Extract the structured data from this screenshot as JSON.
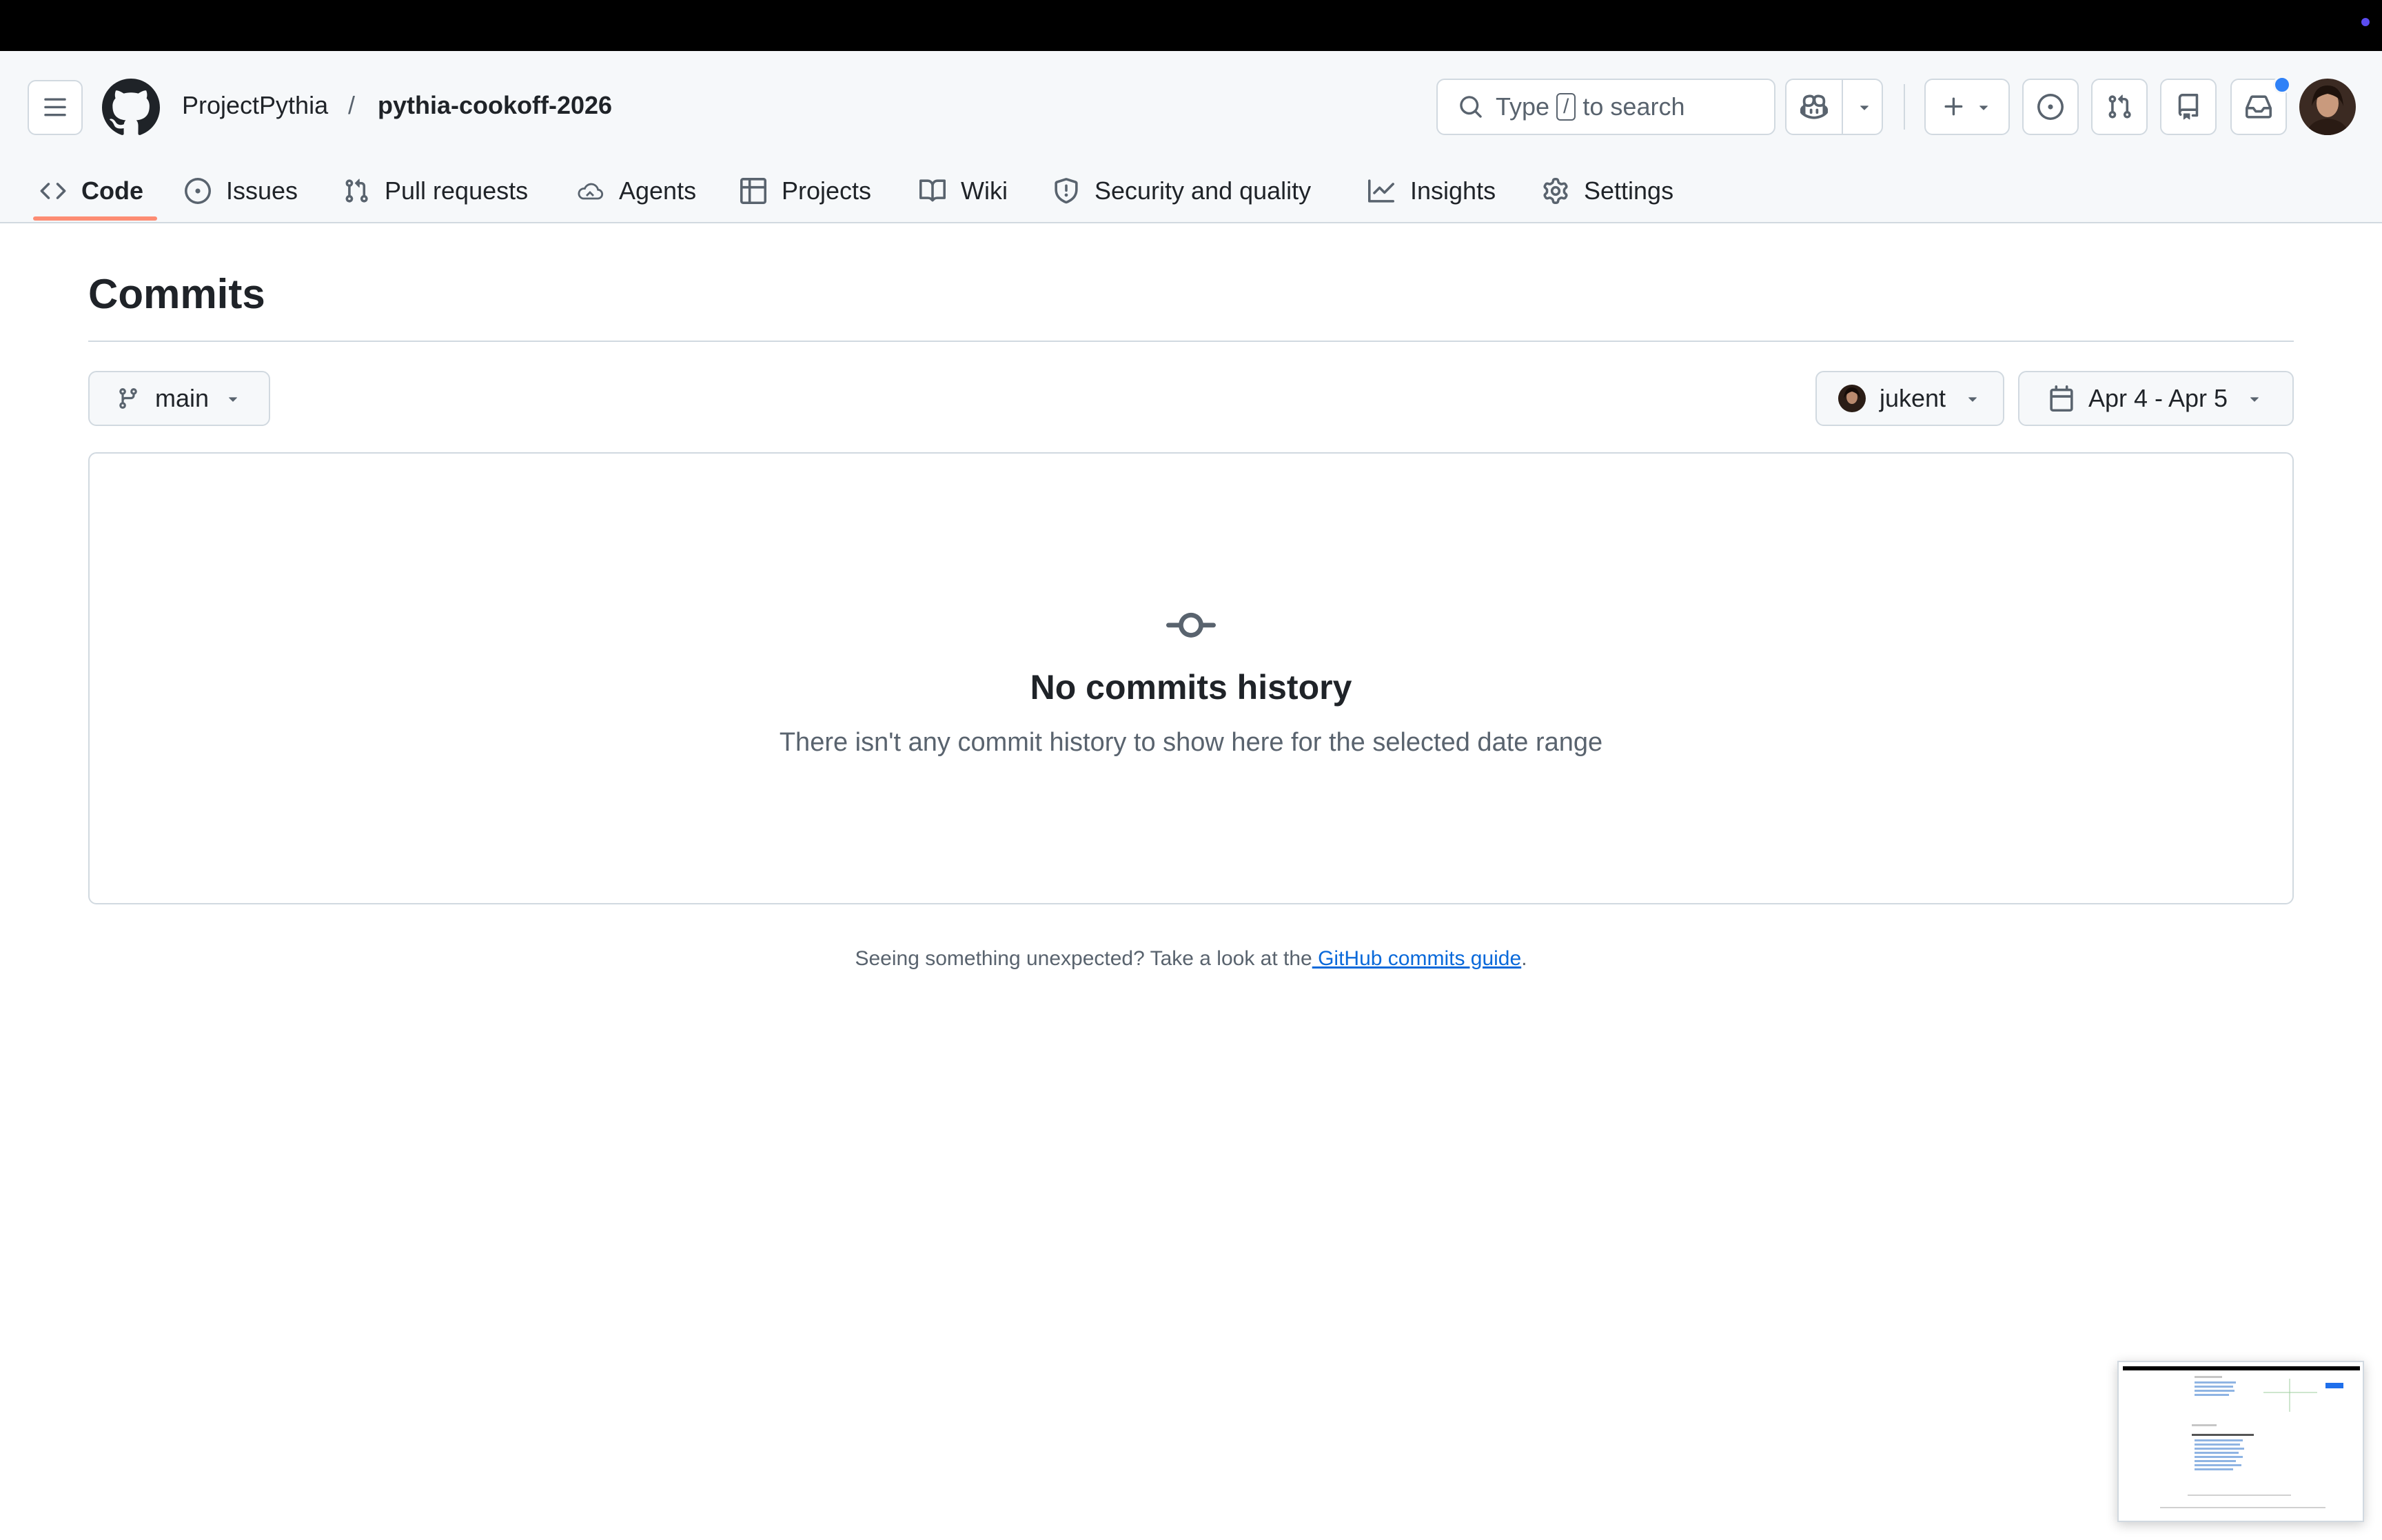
{
  "header": {
    "owner": "ProjectPythia",
    "separator": "/",
    "repo": "pythia-cookoff-2026",
    "search": {
      "prefix": "Type",
      "key": "/",
      "suffix": "to search"
    }
  },
  "tabs": [
    {
      "label": "Code",
      "icon": "code-icon",
      "active": true
    },
    {
      "label": "Issues",
      "icon": "issue-opened-icon"
    },
    {
      "label": "Pull requests",
      "icon": "git-pull-request-icon"
    },
    {
      "label": "Agents",
      "icon": "agent-cloud-icon"
    },
    {
      "label": "Projects",
      "icon": "table-icon"
    },
    {
      "label": "Wiki",
      "icon": "book-icon"
    },
    {
      "label": "Security and quality",
      "icon": "shield-icon"
    },
    {
      "label": "Insights",
      "icon": "graph-icon"
    },
    {
      "label": "Settings",
      "icon": "gear-icon"
    }
  ],
  "page": {
    "title": "Commits",
    "branch": "main",
    "user": "jukent",
    "date_range": "Apr 4 - Apr 5"
  },
  "empty": {
    "title": "No commits history",
    "subtitle": "There isn't any commit history to show here for the selected date range"
  },
  "footer": {
    "text": "Seeing something unexpected? Take a look at the",
    "link": " GitHub commits guide",
    "end": "."
  },
  "colors": {
    "accent_underline": "#fd8c73",
    "link": "#0969da",
    "notification": "#2f81f7"
  }
}
